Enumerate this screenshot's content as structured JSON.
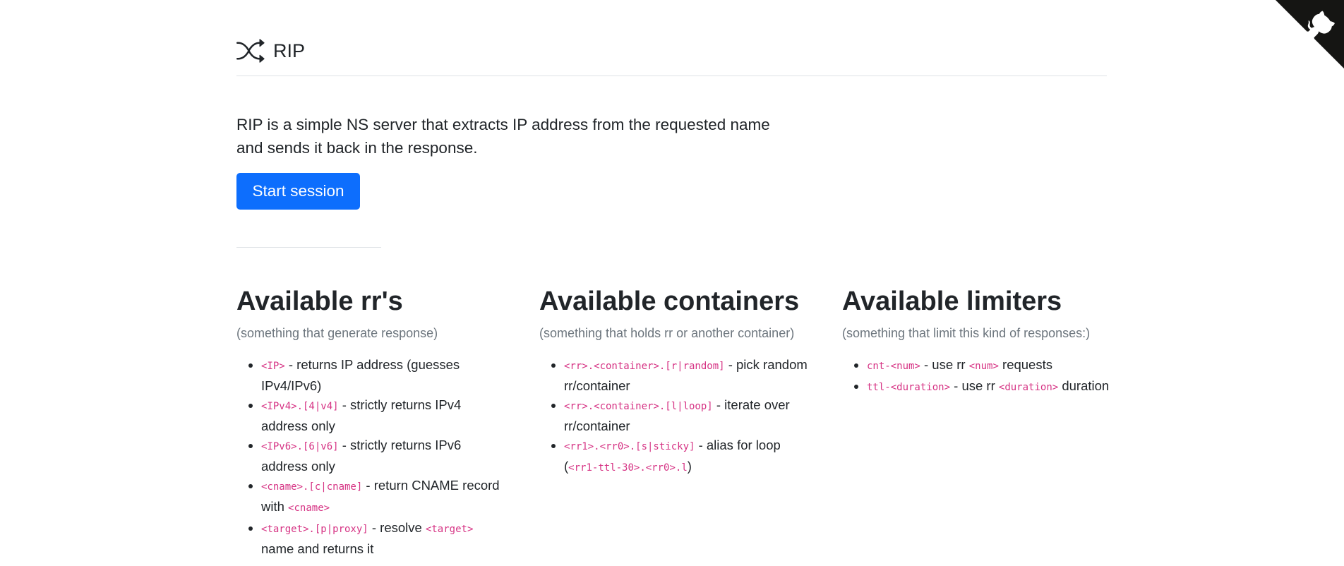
{
  "header": {
    "icon": "shuffle-icon",
    "title": "RIP"
  },
  "github_corner": {
    "icon": "github-octocat-icon",
    "background": "#151513"
  },
  "intro": {
    "text": "RIP is a simple NS server that extracts IP address from the requested name and sends it back in the response.",
    "button_label": "Start session",
    "button_color": "#0d6efd"
  },
  "sections": [
    {
      "title": "Available rr's",
      "subtitle": "(something that generate response)",
      "items": [
        {
          "code1": "<IP>",
          "text1": " - returns IP address (guesses IPv4/IPv6)"
        },
        {
          "code1": "<IPv4>.[4|v4]",
          "text1": " - strictly returns IPv4 address only"
        },
        {
          "code1": "<IPv6>.[6|v6]",
          "text1": " - strictly returns IPv6 address only"
        },
        {
          "code1": "<cname>.[c|cname]",
          "text1": " - return CNAME record with ",
          "code2": "<cname>"
        },
        {
          "code1": "<target>.[p|proxy]",
          "text1": " - resolve ",
          "code2": "<target>",
          "text2": " name and returns it"
        }
      ]
    },
    {
      "title": "Available containers",
      "subtitle": "(something that holds rr or another container)",
      "items": [
        {
          "code1": "<rr>.<container>.[r|random]",
          "text1": " - pick random rr/container"
        },
        {
          "code1": "<rr>.<container>.[l|loop]",
          "text1": " - iterate over rr/container"
        },
        {
          "code1": "<rr1>.<rr0>.[s|sticky]",
          "text1": " - alias for loop (",
          "code2": "<rr1-ttl-30>.<rr0>.l",
          "text2": ")"
        }
      ]
    },
    {
      "title": "Available limiters",
      "subtitle": "(something that limit this kind of responses:)",
      "items": [
        {
          "code1": "cnt-<num>",
          "text1": " - use rr ",
          "code2": "<num>",
          "text2": " requests"
        },
        {
          "code1": "ttl-<duration>",
          "text1": " - use rr ",
          "code2": "<duration>",
          "text2": " duration"
        }
      ]
    }
  ]
}
